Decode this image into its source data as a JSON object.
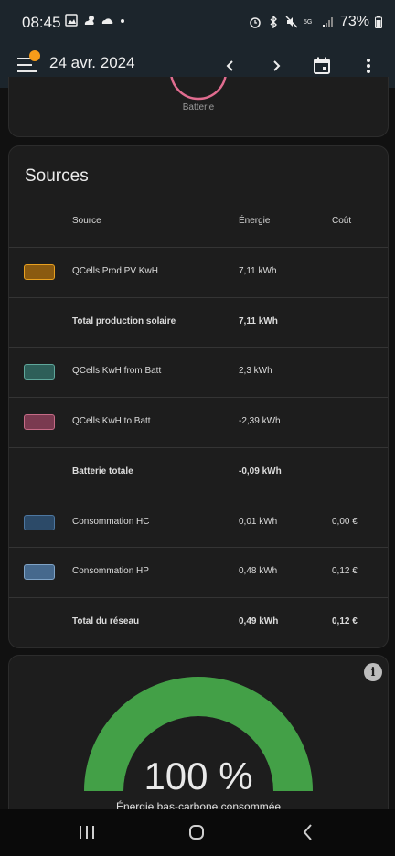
{
  "status_bar": {
    "time": "08:45",
    "battery_percent": "73%",
    "left_icons": [
      "image-icon",
      "cloud-sun-icon",
      "cloud-icon",
      "dot-icon"
    ],
    "right_icons": [
      "alarm-icon",
      "bluetooth-icon",
      "mute-icon",
      "5g-icon",
      "signal-icon",
      "battery-icon"
    ]
  },
  "app_bar": {
    "date": "24 avr. 2024",
    "accent_color": "#f59c1a",
    "icons": [
      "menu-icon",
      "chevron-left-icon",
      "chevron-right-icon",
      "calendar-icon",
      "more-vert-icon"
    ]
  },
  "battery_card": {
    "label": "Batterie",
    "ring_color": "#e06c8f"
  },
  "sources": {
    "title": "Sources",
    "headers": {
      "source": "Source",
      "energy": "Énergie",
      "cost": "Coût"
    },
    "rows": [
      {
        "name": "QCells Prod PV KwH",
        "energy": "7,11 kWh",
        "cost": "",
        "color": "#8a5a10",
        "border": "#e8a020",
        "total": false
      },
      {
        "name": "Total production solaire",
        "energy": "7,11 kWh",
        "cost": "",
        "color": "",
        "border": "",
        "total": true
      },
      {
        "name": "QCells KwH from Batt",
        "energy": "2,3 kWh",
        "cost": "",
        "color": "#2e5f59",
        "border": "#5fa79b",
        "total": false
      },
      {
        "name": "QCells KwH to Batt",
        "energy": "-2,39 kWh",
        "cost": "",
        "color": "#7a3a50",
        "border": "#c56b86",
        "total": false
      },
      {
        "name": "Batterie totale",
        "energy": "-0,09 kWh",
        "cost": "",
        "color": "",
        "border": "",
        "total": true
      },
      {
        "name": "Consommation HC",
        "energy": "0,01 kWh",
        "cost": "0,00 €",
        "color": "#2c4a68",
        "border": "#4d77a0",
        "total": false
      },
      {
        "name": "Consommation HP",
        "energy": "0,48 kWh",
        "cost": "0,12 €",
        "color": "#46698d",
        "border": "#7fa3c6",
        "total": false
      },
      {
        "name": "Total du réseau",
        "energy": "0,49 kWh",
        "cost": "0,12 €",
        "color": "",
        "border": "",
        "total": true
      }
    ]
  },
  "low_carbon": {
    "value": "100 %",
    "fraction": 1.0,
    "caption": "Énergie bas-carbone consommée",
    "gauge_color": "#43a047",
    "info_icon_text": "i"
  },
  "nav_bar": {
    "icons": [
      "recent-apps-icon",
      "home-icon",
      "back-icon"
    ]
  }
}
